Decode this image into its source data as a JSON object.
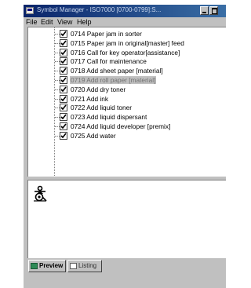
{
  "window": {
    "title": "Symbol Manager - ISO7000   [0700-0799]:S..."
  },
  "menu": {
    "items": [
      "File",
      "Edit",
      "View",
      "Help"
    ]
  },
  "tree": {
    "items": [
      {
        "label": "0714 Paper jam in sorter",
        "checked": true,
        "selected": false
      },
      {
        "label": "0715 Paper jam in original[master] feed",
        "checked": true,
        "selected": false
      },
      {
        "label": "0716 Call for key operator[assistance]",
        "checked": true,
        "selected": false
      },
      {
        "label": "0717 Call for maintenance",
        "checked": true,
        "selected": false
      },
      {
        "label": "0718 Add sheet paper [material]",
        "checked": true,
        "selected": false
      },
      {
        "label": "0719 Add roll paper [material]",
        "checked": true,
        "selected": true
      },
      {
        "label": "0720 Add dry toner",
        "checked": true,
        "selected": false
      },
      {
        "label": "0721 Add ink",
        "checked": true,
        "selected": false
      },
      {
        "label": "0722 Add liquid toner",
        "checked": true,
        "selected": false
      },
      {
        "label": "0723 Add liquid dispersant",
        "checked": true,
        "selected": false
      },
      {
        "label": "0724 Add liquid developer [premix]",
        "checked": true,
        "selected": false
      },
      {
        "label": "0725 Add water",
        "checked": true,
        "selected": false
      }
    ]
  },
  "tabs": {
    "preview_label": "Preview",
    "listing_label": "Listing"
  },
  "colors": {
    "titlebar": "#0a246a",
    "selection": "#c0c0c0",
    "window_bg": "#c0c0c0",
    "preview_tab_icon": "#2e8b57"
  }
}
